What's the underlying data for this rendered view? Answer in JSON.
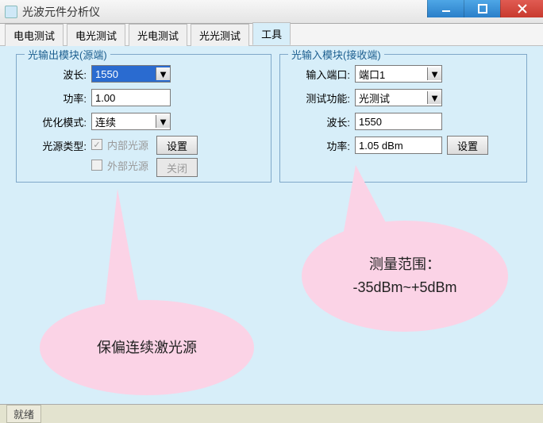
{
  "window": {
    "title": "光波元件分析仪"
  },
  "tabs": {
    "t0": "电电测试",
    "t1": "电光测试",
    "t2": "光电测试",
    "t3": "光光测试",
    "t4": "工具"
  },
  "groupLeft": {
    "legend": "光输出模块(源端)",
    "wavelength_label": "波长:",
    "wavelength_value": "1550",
    "power_label": "功率:",
    "power_value": "1.00",
    "mode_label": "优化模式:",
    "mode_value": "连续",
    "source_label": "光源类型:",
    "source_internal": "内部光源",
    "source_external": "外部光源",
    "set_btn": "设置",
    "close_btn": "关闭"
  },
  "groupRight": {
    "legend": "光输入模块(接收端)",
    "port_label": "输入端口:",
    "port_value": "端口1",
    "func_label": "测试功能:",
    "func_value": "光测试",
    "wavelength_label": "波长:",
    "wavelength_value": "1550",
    "power_label": "功率:",
    "power_value": "1.05 dBm",
    "set_btn": "设置"
  },
  "callout1": {
    "text": "保偏连续激光源"
  },
  "callout2": {
    "line1": "测量范围：",
    "line2": "-35dBm~+5dBm"
  },
  "status": {
    "ready": "就绪"
  }
}
